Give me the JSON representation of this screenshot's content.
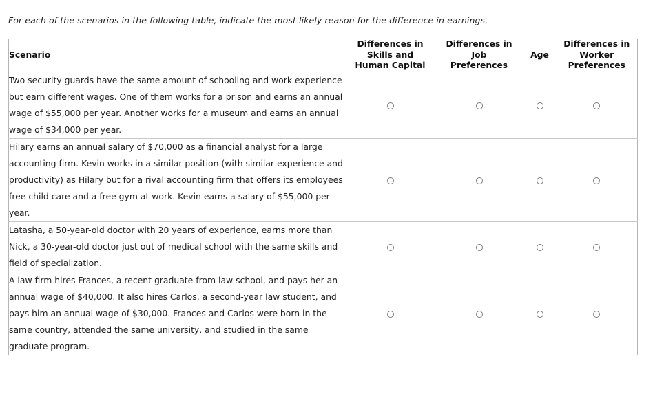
{
  "instruction": "For each of the scenarios in the following table, indicate the most likely reason for the difference in earnings.",
  "table": {
    "columns": [
      {
        "key": "scenario",
        "label": "Scenario",
        "lines": [
          "Scenario"
        ]
      },
      {
        "key": "skills",
        "label": "Differences in Skills and Human Capital",
        "lines": [
          "Differences in",
          "Skills and",
          "Human Capital"
        ]
      },
      {
        "key": "job_prefs",
        "label": "Differences in Job Preferences",
        "lines": [
          "Differences in",
          "Job",
          "Preferences"
        ]
      },
      {
        "key": "age",
        "label": "Age",
        "lines": [
          "Age"
        ]
      },
      {
        "key": "worker_prefs",
        "label": "Differences in Worker Preferences",
        "lines": [
          "Differences in",
          "Worker",
          "Preferences"
        ]
      }
    ],
    "rows": [
      {
        "scenario": "Two security guards have the same amount of schooling and work experience but earn different wages. One of them works for a prison and earns an annual wage of $55,000 per year. Another works for a museum and earns an annual wage of $34,000 per year.",
        "selected": null
      },
      {
        "scenario": "Hilary earns an annual salary of $70,000 as a financial analyst for a large accounting firm. Kevin works in a similar position (with similar experience and productivity) as Hilary but for a rival accounting firm that offers its employees free child care and a free gym at work. Kevin earns a salary of $55,000 per year.",
        "selected": null
      },
      {
        "scenario": "Latasha, a 50-year-old doctor with 20 years of experience, earns more than Nick, a 30-year-old doctor just out of medical school with the same skills and field of specialization.",
        "selected": null
      },
      {
        "scenario": "A law firm hires Frances, a recent graduate from law school, and pays her an annual wage of $40,000. It also hires Carlos, a second-year law student, and pays him an annual wage of $30,000. Frances and Carlos were born in the same country, attended the same university, and studied in the same graduate program.",
        "selected": null
      }
    ]
  },
  "colors": {
    "page_background": "#ffffff",
    "table_border": "#b5b5b5",
    "header_rule": "#9a9a9a",
    "row_rule": "#c9c9c9",
    "text": "#222222",
    "radio_border": "#7b7b7b"
  }
}
